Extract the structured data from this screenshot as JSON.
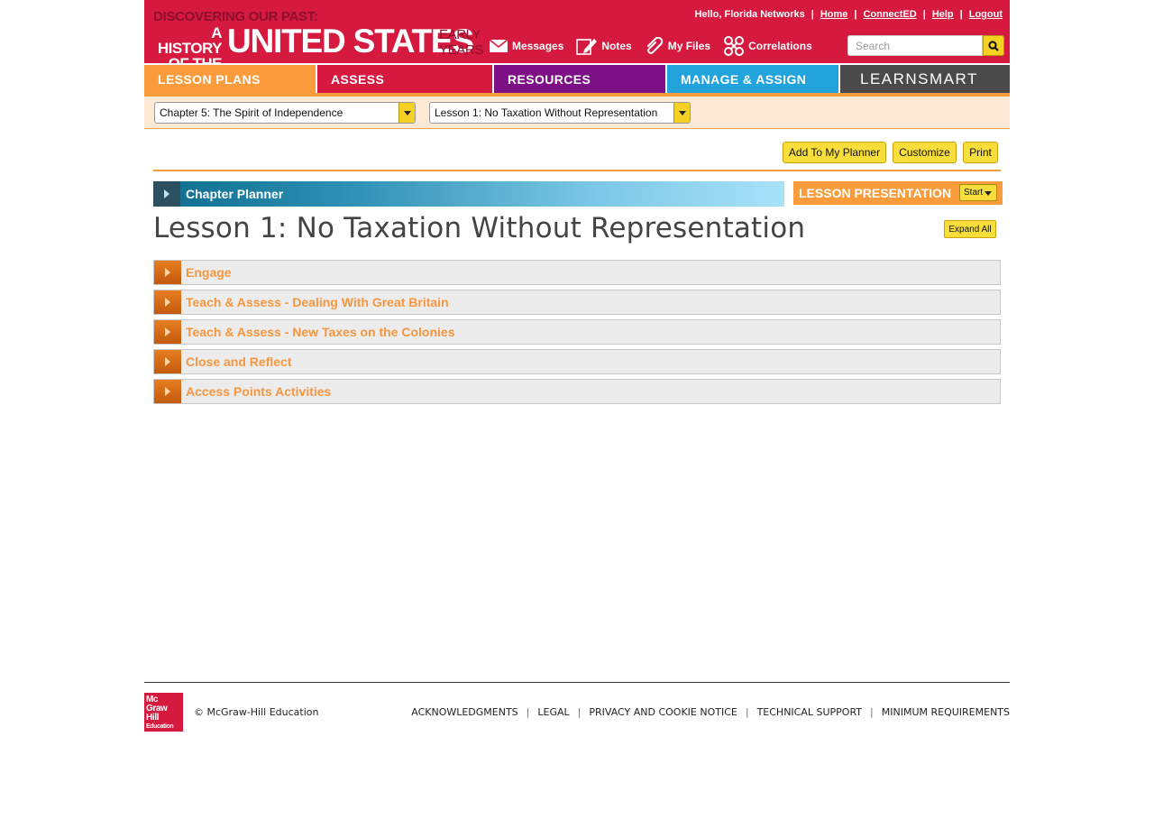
{
  "brand": {
    "line1": "DISCOVERING OUR PAST:",
    "line2": "A HISTORY OF THE",
    "line3": "UNITED STATES",
    "line4": "EARLY YEARS"
  },
  "user": {
    "greeting": "Hello, Florida Networks",
    "links": [
      "Home",
      "ConnectED",
      "Help",
      "Logout"
    ]
  },
  "tools": [
    {
      "label": "Messages",
      "icon": "envelope-icon"
    },
    {
      "label": "Notes",
      "icon": "pencil-icon"
    },
    {
      "label": "My Files",
      "icon": "paperclip-icon"
    },
    {
      "label": "Correlations",
      "icon": "correlations-icon"
    }
  ],
  "search": {
    "placeholder": "Search",
    "icon": "search-icon"
  },
  "tabs": {
    "lesson_plans": "LESSON PLANS",
    "assess": "ASSESS",
    "resources": "RESOURCES",
    "manage_assign": "MANAGE & ASSIGN",
    "learnsmart": "LEARNSMART"
  },
  "colors": {
    "header": "#d6193f",
    "lesson_plans": "#fa9c3c",
    "resources": "#7d1085",
    "manage": "#23a3db",
    "learnsmart": "#4a4a4a",
    "button": "#f8de3a"
  },
  "selectors": {
    "chapter": "Chapter 5: The Spirit of Independence",
    "lesson": "Lesson 1: No Taxation Without Representation"
  },
  "actions": {
    "add_to_planner": "Add To My Planner",
    "customize": "Customize",
    "print": "Print"
  },
  "chapter_planner": "Chapter Planner",
  "lesson_presentation": {
    "title": "LESSON PRESENTATION",
    "start": "Start"
  },
  "lesson_title": "Lesson 1: No Taxation Without Representation",
  "expand_all": "Expand All",
  "sections": [
    "Engage",
    "Teach & Assess - Dealing With Great Britain",
    "Teach & Assess - New Taxes on the Colonies",
    "Close and Reflect",
    "Access Points Activities"
  ],
  "footer": {
    "logo_lines": [
      "Mc",
      "Graw",
      "Hill",
      "Education"
    ],
    "copyright": "© McGraw-Hill Education",
    "links": [
      "ACKNOWLEDGMENTS",
      "LEGAL",
      "PRIVACY AND COOKIE NOTICE",
      "TECHNICAL SUPPORT",
      "MINIMUM REQUIREMENTS"
    ]
  }
}
